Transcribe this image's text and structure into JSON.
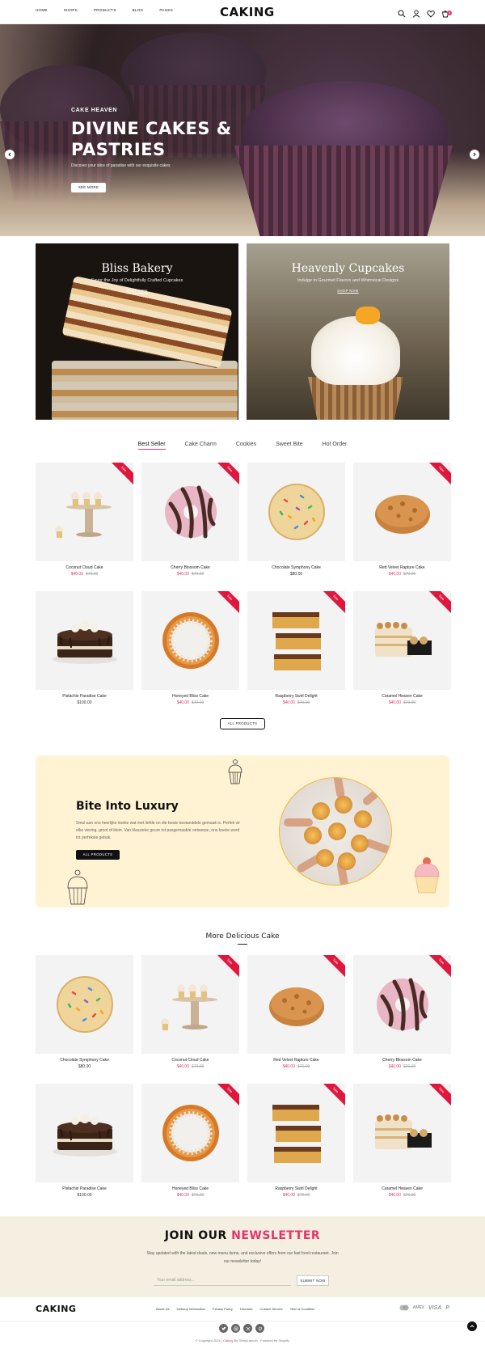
{
  "header": {
    "nav": [
      "HOME",
      "SHOPS",
      "PRODUCTS",
      "BLOG",
      "PAGES"
    ],
    "logo": "CAKING",
    "cart_count": "0"
  },
  "hero": {
    "subtitle": "CAKE HEAVEN",
    "title_line1": "DIVINE CAKES &",
    "title_line2": "PASTRIES",
    "description": "Discover your slice of paradise with our exquisite cakes",
    "button": "SEE MORE"
  },
  "banners": [
    {
      "title": "Bliss Bakery",
      "subtitle": "Savor the Joy of Delightfully Crafted Cupcakes",
      "link": "SHOP NOW"
    },
    {
      "title": "Heavenly Cupcakes",
      "subtitle": "Indulge in Gourmet Flavors and Whimsical Designs",
      "link": "SHOP NOW"
    }
  ],
  "tabs": [
    "Best Seller",
    "Cake Charm",
    "Cookies",
    "Sweet Bite",
    "Hot Order"
  ],
  "sale_label": "Sale",
  "products": [
    {
      "name": "Coconut Cloud Cake",
      "price": "$40.00",
      "old": "$70.00",
      "sale": true,
      "img": "cupcake-stand"
    },
    {
      "name": "Cherry Blossom Cake",
      "price": "$40.00",
      "old": "$70.00",
      "sale": true,
      "img": "donut"
    },
    {
      "name": "Chocolate Symphony Cake",
      "price": "$80.00",
      "old": "",
      "sale": false,
      "img": "sprinkle-cookie"
    },
    {
      "name": "Red Velvet Rapture Cake",
      "price": "$40.00",
      "old": "$70.00",
      "sale": true,
      "img": "cookie"
    },
    {
      "name": "Pistachio Paradise Cake",
      "price": "$100.00",
      "old": "",
      "sale": false,
      "img": "choc-cake"
    },
    {
      "name": "Honeyed Bliss Cake",
      "price": "$40.00",
      "old": "$70.00",
      "sale": true,
      "img": "tart"
    },
    {
      "name": "Raspberry Swirl Delight",
      "price": "$40.00",
      "old": "$70.00",
      "sale": true,
      "img": "stack"
    },
    {
      "name": "Caramel Heaven Cake",
      "price": "$40.00",
      "old": "$70.00",
      "sale": true,
      "img": "layer-cake"
    }
  ],
  "all_products_button": "ALL PRODUCTS",
  "luxury": {
    "title": "Bite Into Luxury",
    "description": "Smul aan ons heerlijke koeke wat met liefde en die beste bestanddele gemaak is. Perfek vir elke viering, groot of klein. Van klassieke geure tot pasgemaakte ontwerpe, ons koeke word tot perfeksie gebak.",
    "button": "ALL PRODUCTS"
  },
  "more_title": "More Delicious Cake",
  "more_products": [
    {
      "name": "Chocolate Symphony Cake",
      "price": "$80.00",
      "old": "",
      "sale": false,
      "img": "sprinkle-cookie"
    },
    {
      "name": "Coconut Cloud Cake",
      "price": "$40.00",
      "old": "$70.00",
      "sale": true,
      "img": "cupcake-stand"
    },
    {
      "name": "Red Velvet Rapture Cake",
      "price": "$40.00",
      "old": "$70.00",
      "sale": true,
      "img": "cookie"
    },
    {
      "name": "Cherry Blossom Cake",
      "price": "$40.00",
      "old": "$70.00",
      "sale": true,
      "img": "donut"
    },
    {
      "name": "Pistachio Paradise Cake",
      "price": "$100.00",
      "old": "",
      "sale": false,
      "img": "choc-cake"
    },
    {
      "name": "Honeyed Bliss Cake",
      "price": "$40.00",
      "old": "$70.00",
      "sale": true,
      "img": "tart"
    },
    {
      "name": "Raspberry Swirl Delight",
      "price": "$40.00",
      "old": "$70.00",
      "sale": true,
      "img": "stack"
    },
    {
      "name": "Caramel Heaven Cake",
      "price": "$40.00",
      "old": "$70.00",
      "sale": true,
      "img": "layer-cake"
    }
  ],
  "newsletter": {
    "title_plain": "JOIN OUR ",
    "title_accent": "NEWSLETTER",
    "description": "Stay updated with the latest deals, new menu items, and exclusive offers from our fast food restaurant. Join our newsletter today!",
    "placeholder": "Your email address...",
    "button": "SUBMIT NOW"
  },
  "footer": {
    "logo": "CAKING",
    "links": [
      "About Us",
      "Delivery Information",
      "Privacy Policy",
      "Discount",
      "Custom Service",
      "Term & Condition"
    ],
    "payments": [
      "AMEX",
      "VISA",
      "P"
    ],
    "copyright_prefix": "© Copyright 2024 | ",
    "copyright_brand": "Caking",
    "copyright_mid": " By ShopiLaunch",
    "copyright_suffix": " . Powered by Shopify."
  },
  "colors": {
    "accent": "#e6336b",
    "sale": "#e0173d",
    "cream": "#fff3d3"
  }
}
